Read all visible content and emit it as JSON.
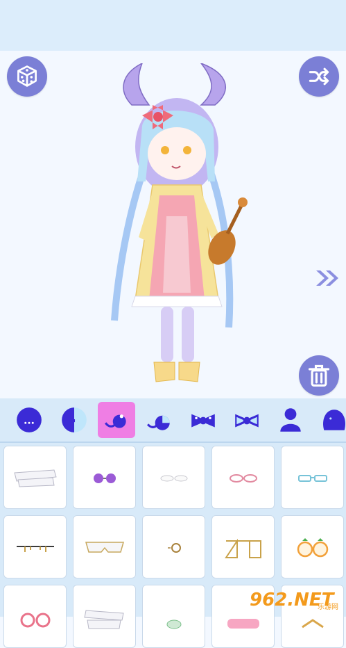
{
  "colors": {
    "header_bg": "#dcedfb",
    "stage_bg": "#f3f8ff",
    "button_purple": "#7b7fd6",
    "category_active": "#ef7ee4",
    "panel_bg": "#d8eaf9"
  },
  "toolbar": {
    "random_icon": "dice-icon",
    "shuffle_icon": "shuffle-icon",
    "next_icon": "double-chevron-right-icon",
    "delete_icon": "trash-icon"
  },
  "categories": [
    {
      "name": "face-shape",
      "icon": "face-icon",
      "active": false
    },
    {
      "name": "face-half",
      "icon": "face-half-icon",
      "active": false
    },
    {
      "name": "glasses",
      "icon": "glasses-icon",
      "active": true
    },
    {
      "name": "eyepatch",
      "icon": "eyepatch-icon",
      "active": false
    },
    {
      "name": "bow-tie",
      "icon": "bow-icon",
      "active": false
    },
    {
      "name": "bow-light",
      "icon": "bow-light-icon",
      "active": false
    },
    {
      "name": "body",
      "icon": "body-icon",
      "active": false
    },
    {
      "name": "blob",
      "icon": "blob-icon",
      "active": false
    }
  ],
  "items": [
    {
      "icon": "bandage-glasses-icon"
    },
    {
      "icon": "round-purple-glasses-icon"
    },
    {
      "icon": "thin-white-glasses-icon"
    },
    {
      "icon": "pink-oval-glasses-icon"
    },
    {
      "icon": "blue-rect-glasses-icon"
    },
    {
      "icon": "chain-glasses-icon"
    },
    {
      "icon": "shield-sunglasses-icon"
    },
    {
      "icon": "monocle-icon"
    },
    {
      "icon": "gold-frame-glasses-icon"
    },
    {
      "icon": "strawberry-glasses-icon"
    },
    {
      "icon": "flower-glasses-icon"
    },
    {
      "icon": "wrap-bandage-icon"
    },
    {
      "icon": "green-glasses-icon"
    },
    {
      "icon": "pink-heart-glasses-icon"
    },
    {
      "icon": "gold-round-glasses-icon"
    }
  ],
  "watermark": {
    "logo": "962.NET",
    "sub": "乐游网"
  }
}
